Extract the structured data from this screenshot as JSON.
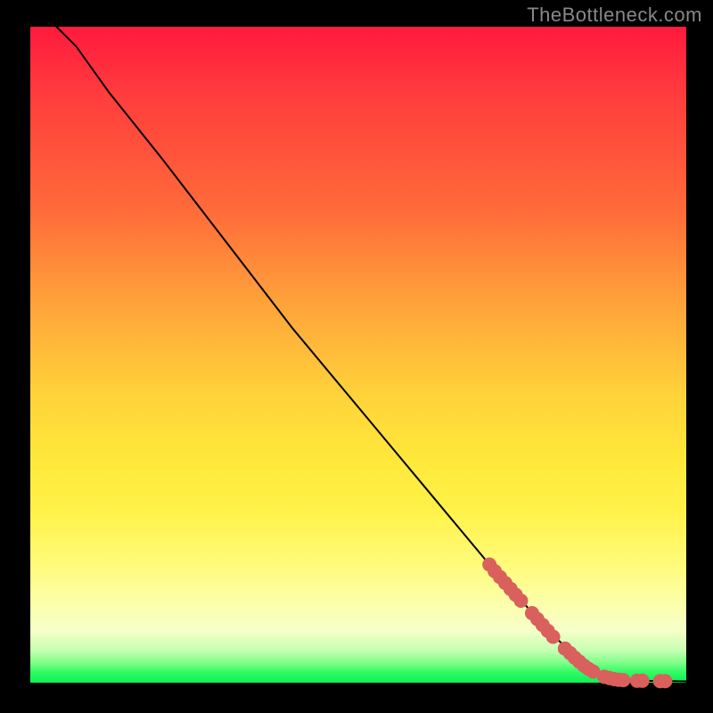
{
  "watermark": "TheBottleneck.com",
  "chart_data": {
    "type": "line",
    "title": "",
    "xlabel": "",
    "ylabel": "",
    "xlim": [
      0,
      100
    ],
    "ylim": [
      0,
      100
    ],
    "grid": false,
    "curve": [
      {
        "x": 4,
        "y": 100
      },
      {
        "x": 7,
        "y": 97
      },
      {
        "x": 12,
        "y": 90
      },
      {
        "x": 20,
        "y": 80
      },
      {
        "x": 30,
        "y": 67
      },
      {
        "x": 40,
        "y": 54
      },
      {
        "x": 50,
        "y": 42
      },
      {
        "x": 60,
        "y": 30
      },
      {
        "x": 70,
        "y": 18
      },
      {
        "x": 78,
        "y": 9
      },
      {
        "x": 84,
        "y": 3
      },
      {
        "x": 88,
        "y": 1
      },
      {
        "x": 92,
        "y": 0.3
      },
      {
        "x": 100,
        "y": 0.2
      }
    ],
    "points_cluster_a": [
      {
        "x": 70,
        "y": 18
      },
      {
        "x": 70.8,
        "y": 17
      },
      {
        "x": 71.6,
        "y": 16.1
      },
      {
        "x": 72.4,
        "y": 15.2
      },
      {
        "x": 73.2,
        "y": 14.3
      },
      {
        "x": 74.0,
        "y": 13.4
      },
      {
        "x": 74.8,
        "y": 12.5
      }
    ],
    "points_cluster_b": [
      {
        "x": 76.5,
        "y": 10.6
      },
      {
        "x": 77.3,
        "y": 9.7
      },
      {
        "x": 78.1,
        "y": 8.8
      },
      {
        "x": 78.9,
        "y": 7.9
      },
      {
        "x": 79.7,
        "y": 7.0
      }
    ],
    "points_cluster_c": [
      {
        "x": 81.5,
        "y": 5.2
      },
      {
        "x": 82.3,
        "y": 4.5
      },
      {
        "x": 83.0,
        "y": 3.8
      },
      {
        "x": 83.7,
        "y": 3.2
      },
      {
        "x": 84.4,
        "y": 2.6
      },
      {
        "x": 85.1,
        "y": 2.1
      },
      {
        "x": 85.8,
        "y": 1.7
      }
    ],
    "points_cluster_d": [
      {
        "x": 87.5,
        "y": 0.9
      },
      {
        "x": 88.3,
        "y": 0.7
      },
      {
        "x": 89.0,
        "y": 0.55
      },
      {
        "x": 89.7,
        "y": 0.45
      },
      {
        "x": 90.4,
        "y": 0.4
      }
    ],
    "points_cluster_e": [
      {
        "x": 92.5,
        "y": 0.3
      },
      {
        "x": 93.3,
        "y": 0.3
      }
    ],
    "points_cluster_f": [
      {
        "x": 96.0,
        "y": 0.25
      },
      {
        "x": 96.8,
        "y": 0.25
      }
    ],
    "dot_radius_px": 8
  }
}
